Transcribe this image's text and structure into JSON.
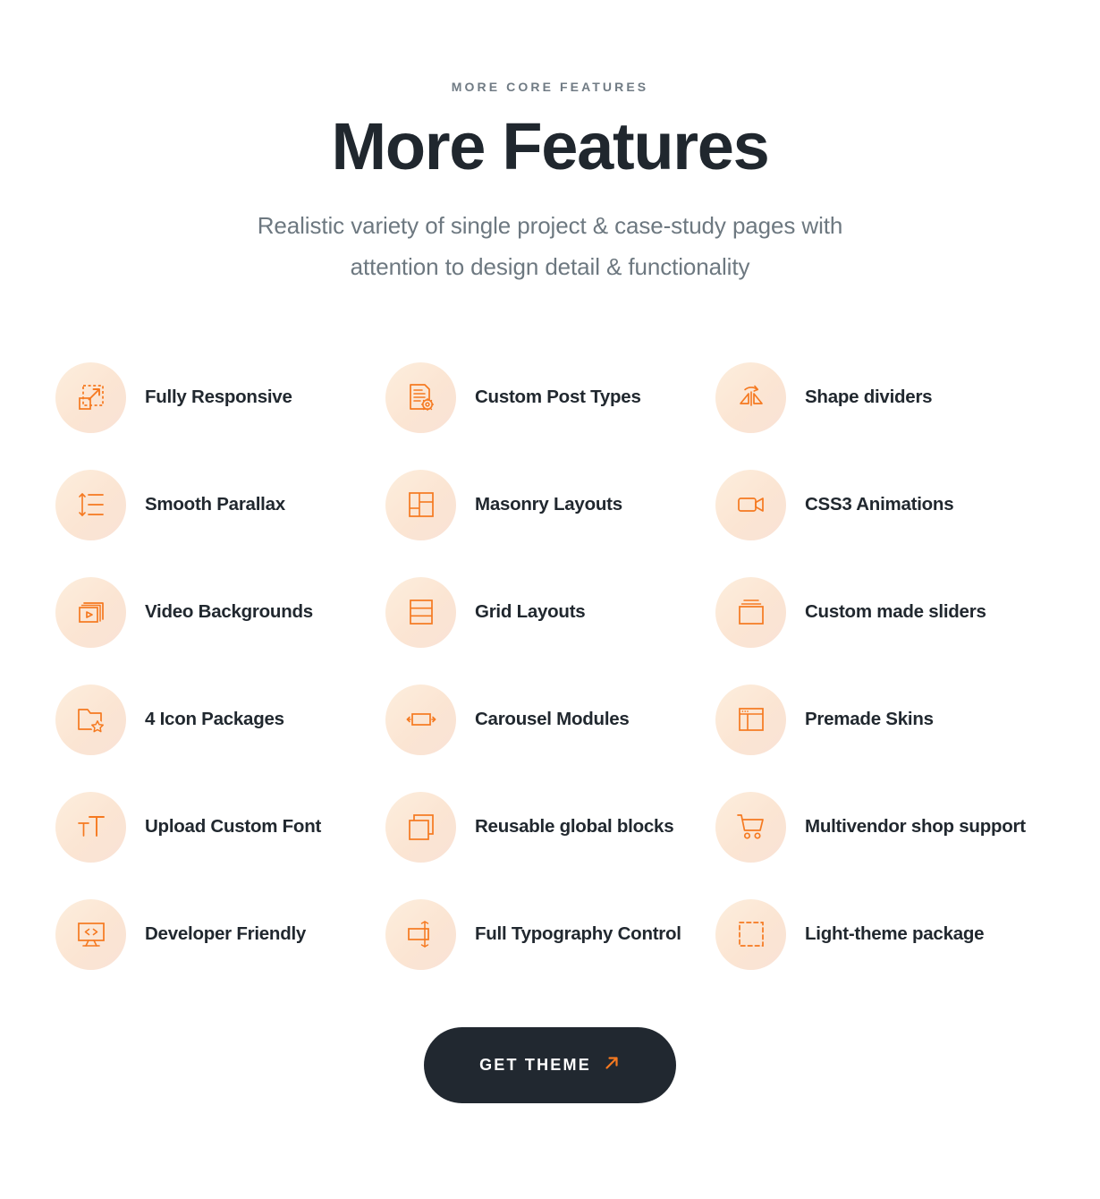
{
  "header": {
    "eyebrow": "MORE CORE FEATURES",
    "headline": "More Features",
    "subtitle_line1": "Realistic variety of single project & case-study pages with",
    "subtitle_line2": "attention to design detail & functionality"
  },
  "colors": {
    "accent": "#F57920",
    "icon_circle_bg": "#FBE7D4",
    "heading": "#20272E",
    "body_text": "#6D7880",
    "eyebrow_text": "#707B84",
    "cta_bg": "#212830",
    "cta_text": "#FFFFFF"
  },
  "features": [
    {
      "label": "Fully Responsive",
      "icon": "resize-expand-icon"
    },
    {
      "label": "Custom Post Types",
      "icon": "document-gear-icon"
    },
    {
      "label": "Shape dividers",
      "icon": "mirror-flip-icon"
    },
    {
      "label": "Smooth Parallax",
      "icon": "vertical-scroll-lines-icon"
    },
    {
      "label": "Masonry Layouts",
      "icon": "masonry-grid-icon"
    },
    {
      "label": "CSS3 Animations",
      "icon": "video-camera-icon"
    },
    {
      "label": "Video Backgrounds",
      "icon": "video-stack-play-icon"
    },
    {
      "label": "Grid Layouts",
      "icon": "row-grid-icon"
    },
    {
      "label": "Custom made sliders",
      "icon": "stacked-slides-icon"
    },
    {
      "label": "4 Icon Packages",
      "icon": "folder-star-icon"
    },
    {
      "label": "Carousel Modules",
      "icon": "carousel-arrows-icon"
    },
    {
      "label": "Premade Skins",
      "icon": "browser-sidebar-icon"
    },
    {
      "label": "Upload Custom Font",
      "icon": "font-size-icon"
    },
    {
      "label": "Reusable global blocks",
      "icon": "copy-squares-icon"
    },
    {
      "label": "Multivendor shop support",
      "icon": "shopping-cart-icon"
    },
    {
      "label": "Developer Friendly",
      "icon": "monitor-code-icon"
    },
    {
      "label": "Full Typography Control",
      "icon": "line-height-icon"
    },
    {
      "label": "Light-theme package",
      "icon": "dashed-square-icon"
    }
  ],
  "cta": {
    "label": "GET THEME",
    "icon": "arrow-up-right-icon"
  }
}
